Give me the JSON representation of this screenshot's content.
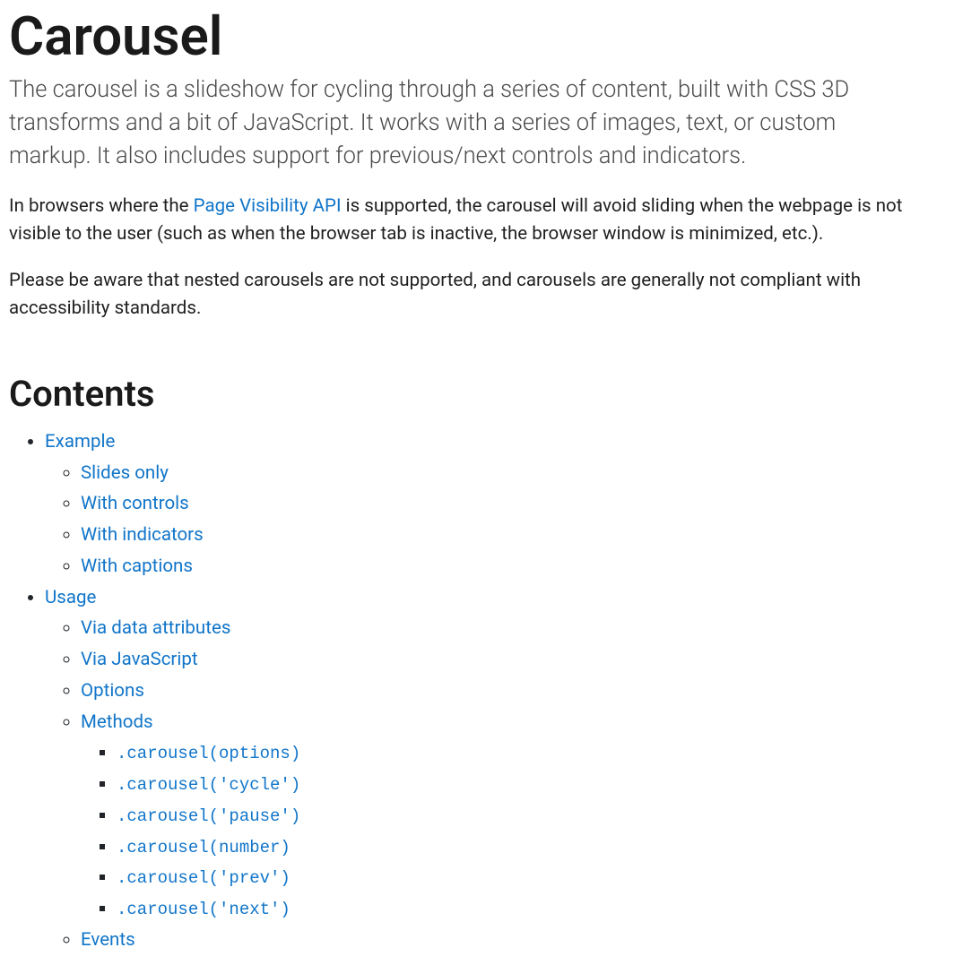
{
  "title": "Carousel",
  "lead": "The carousel is a slideshow for cycling through a series of content, built with CSS 3D transforms and a bit of JavaScript. It works with a series of images, text, or custom markup. It also includes support for previous/next controls and indicators.",
  "para1": {
    "prefix": "In browsers where the ",
    "linkText": "Page Visibility API",
    "suffix": " is supported, the carousel will avoid sliding when the webpage is not visible to the user (such as when the browser tab is inactive, the browser window is minimized, etc.)."
  },
  "para2": "Please be aware that nested carousels are not supported, and carousels are generally not compliant with accessibility standards.",
  "contentsHeading": "Contents",
  "toc": {
    "example": {
      "label": "Example",
      "children": {
        "slidesOnly": "Slides only",
        "withControls": "With controls",
        "withIndicators": "With indicators",
        "withCaptions": "With captions"
      }
    },
    "usage": {
      "label": "Usage",
      "children": {
        "viaDataAttributes": "Via data attributes",
        "viaJavascript": "Via JavaScript",
        "options": "Options",
        "methods": {
          "label": "Methods",
          "children": {
            "m0": ".carousel(options)",
            "m1": ".carousel('cycle')",
            "m2": ".carousel('pause')",
            "m3": ".carousel(number)",
            "m4": ".carousel('prev')",
            "m5": ".carousel('next')"
          }
        },
        "events": "Events"
      }
    }
  }
}
